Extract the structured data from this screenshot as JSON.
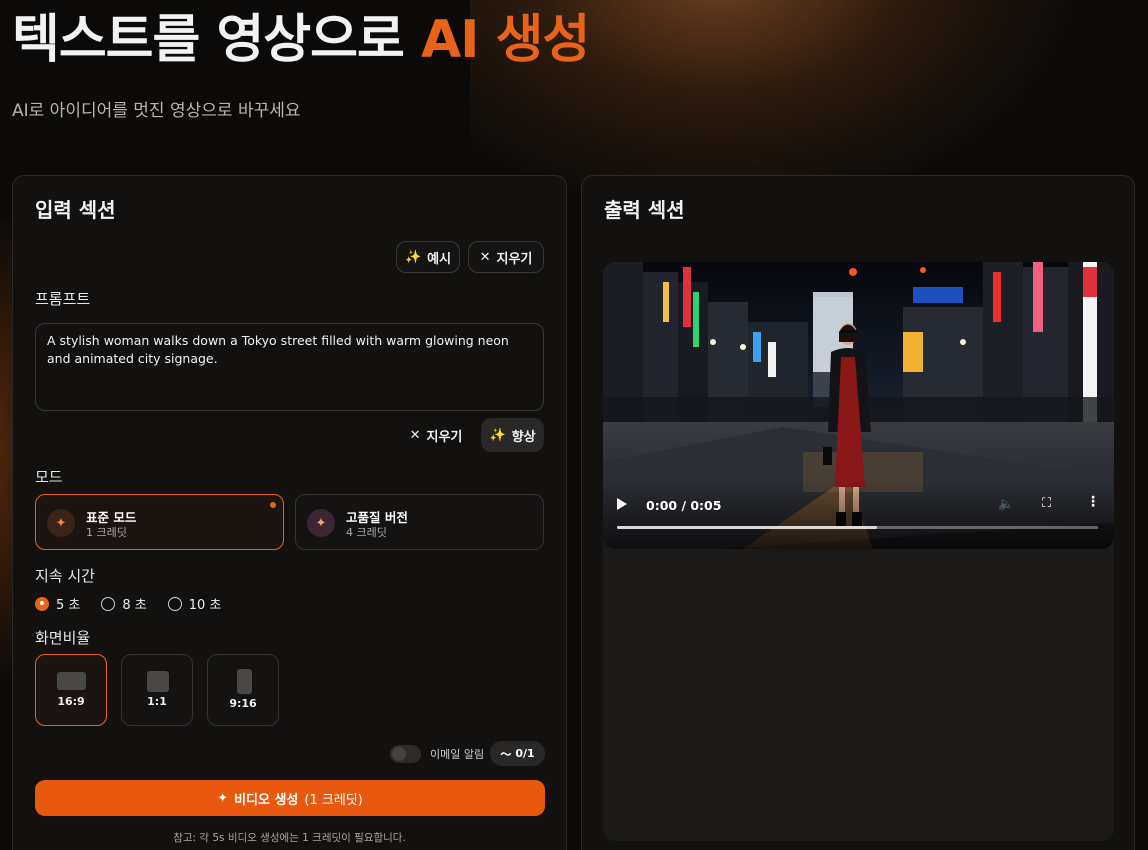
{
  "hero": {
    "title_main": "텍스트를 영상으로 ",
    "title_accent": "AI 생성",
    "subtitle": "AI로 아이디어를 멋진 영상으로 바꾸세요"
  },
  "input": {
    "title": "입력 섹션",
    "example_button": "예시",
    "clear_button": "지우기",
    "prompt_label": "프롬프트",
    "prompt_value": "A stylish woman walks down a Tokyo street filled with warm glowing neon and animated city signage.",
    "prompt_clear": "지우기",
    "enhance_button": "향상",
    "mode_label": "모드",
    "modes": [
      {
        "title": "표준 모드",
        "credits": "1 크레딧",
        "selected": true
      },
      {
        "title": "고품질 버전",
        "credits": "4 크레딧",
        "selected": false
      }
    ],
    "duration_label": "지속 시간",
    "durations": [
      "5 초",
      "8 초",
      "10 초"
    ],
    "duration_selected": "5 초",
    "aspect_label": "화면비율",
    "aspects": [
      "16:9",
      "1:1",
      "9:16"
    ],
    "aspect_selected": "16:9",
    "email_toggle_label": "이메일 알림",
    "email_enabled": false,
    "counter": "0/1",
    "generate_label": "비디오 생성",
    "generate_cost": "(1 크레딧)",
    "note": "참고: 각 5s 비디오 생성에는 1 크레딧이 필요합니다."
  },
  "output": {
    "title": "출력 섹션",
    "video_time": "0:00 / 0:05",
    "video_progress": 0.54
  },
  "colors": {
    "accent": "#e8631a",
    "background": "#0b0a09",
    "panel": "#121110"
  }
}
